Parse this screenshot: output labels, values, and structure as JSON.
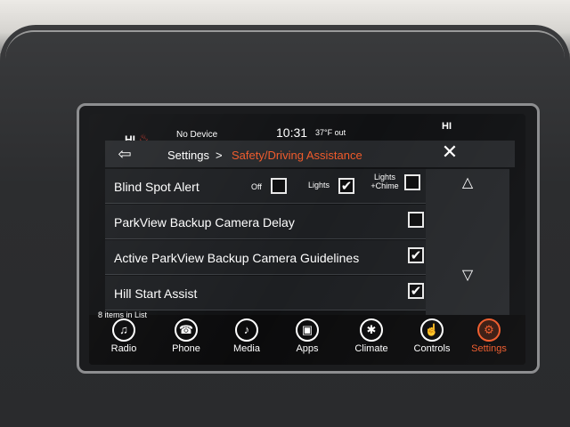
{
  "status": {
    "hi_left": "HI",
    "device": "No Device",
    "time": "10:31",
    "temperature": "37°F out",
    "hi_right": "HI"
  },
  "header": {
    "back_icon": "back-arrow-icon",
    "breadcrumb_root": "Settings",
    "breadcrumb_separator": ">",
    "breadcrumb_current": "Safety/Driving Assistance",
    "close_label": "✕"
  },
  "settings": [
    {
      "label": "Blind Spot Alert",
      "options": [
        {
          "label": "Off",
          "checked": false
        },
        {
          "label": "Lights",
          "checked": true
        },
        {
          "label": "Lights +Chime",
          "checked": false
        }
      ]
    },
    {
      "label": "ParkView Backup Camera Delay",
      "checked": false
    },
    {
      "label": "Active ParkView Backup Camera Guidelines",
      "checked": true
    },
    {
      "label": "Hill Start Assist",
      "checked": true
    }
  ],
  "list_count": "8 items in List",
  "scroll": {
    "up": "△",
    "down": "▽"
  },
  "apps": [
    {
      "label": "Radio",
      "icon": "radio-icon",
      "glyph": "♫"
    },
    {
      "label": "Phone",
      "icon": "phone-icon",
      "glyph": "☎"
    },
    {
      "label": "Media",
      "icon": "media-icon",
      "glyph": "♪"
    },
    {
      "label": "Apps",
      "icon": "apps-icon",
      "glyph": "▣"
    },
    {
      "label": "Climate",
      "icon": "climate-icon",
      "glyph": "✱"
    },
    {
      "label": "Controls",
      "icon": "controls-icon",
      "glyph": "☝"
    },
    {
      "label": "Settings",
      "icon": "settings-icon",
      "glyph": "⚙",
      "active": true
    }
  ],
  "colors": {
    "accent": "#f05a2a",
    "screen_bg": "#101113",
    "seat_icon": "#e23b2e"
  }
}
